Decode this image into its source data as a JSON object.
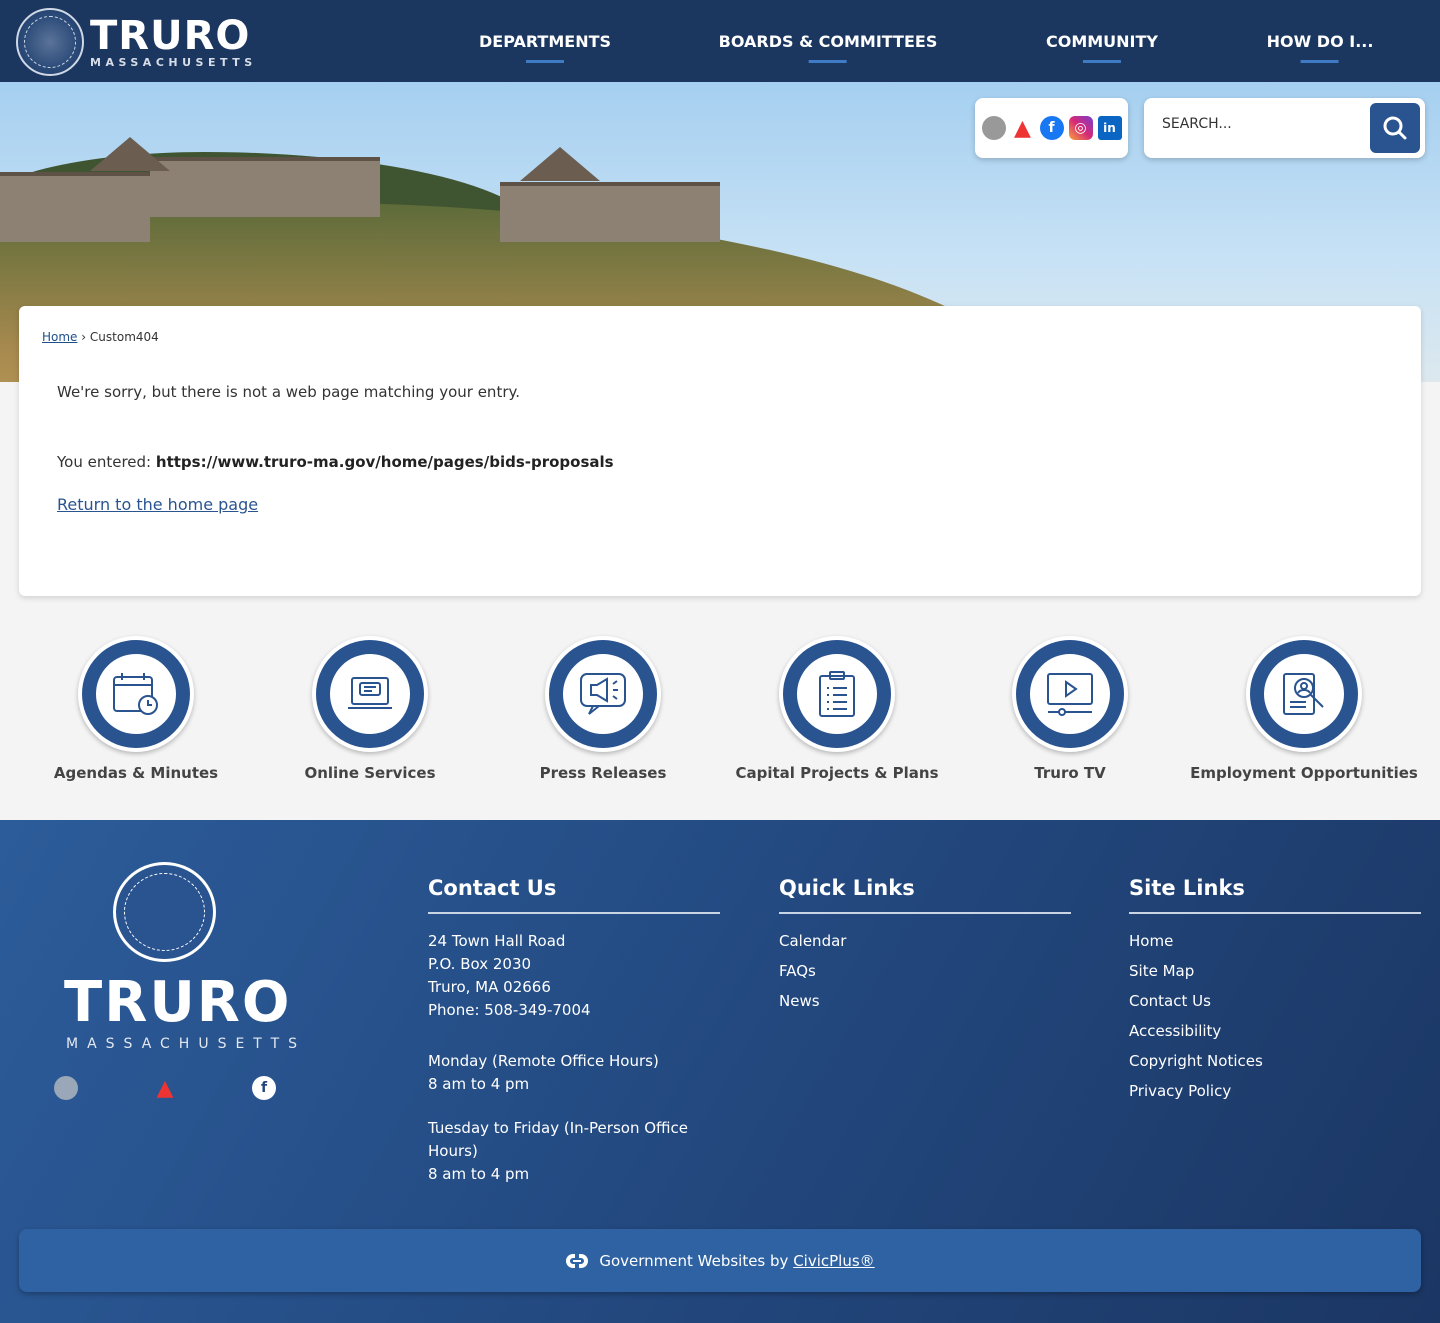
{
  "header": {
    "logo_title": "TRURO",
    "logo_subtitle": "MASSACHUSETTS",
    "nav": [
      "DEPARTMENTS",
      "BOARDS & COMMITTEES",
      "COMMUNITY",
      "HOW DO I..."
    ]
  },
  "search": {
    "placeholder": "SEARCH..."
  },
  "breadcrumb": {
    "home": "Home",
    "sep": "›",
    "current": "Custom404"
  },
  "content": {
    "message": "We're sorry, but there is not a web page matching your entry.",
    "entered_label": "You entered:",
    "entered_url": "https://www.truro-ma.gov/home/pages/bids-proposals",
    "return_link": "Return to the home page"
  },
  "tiles": [
    "Agendas & Minutes",
    "Online Services",
    "Press Releases",
    "Capital Projects & Plans",
    "Truro TV",
    "Employment Opportunities"
  ],
  "footer": {
    "logo_title": "TRURO",
    "logo_subtitle": "MASSACHUSETTS",
    "contact": {
      "heading": "Contact Us",
      "lines": [
        "24 Town Hall Road",
        "P.O. Box 2030",
        "Truro, MA 02666",
        "Phone: 508-349-7004"
      ],
      "hours1": [
        "Monday (Remote Office Hours)",
        "8 am to 4 pm"
      ],
      "hours2": [
        "Tuesday to Friday (In-Person Office Hours)",
        "8 am to 4 pm"
      ]
    },
    "quick": {
      "heading": "Quick Links",
      "links": [
        "Calendar",
        "FAQs",
        "News"
      ]
    },
    "site": {
      "heading": "Site Links",
      "links": [
        "Home",
        "Site Map",
        "Contact Us",
        "Accessibility",
        "Copyright Notices",
        "Privacy Policy"
      ]
    },
    "credit": "Government Websites by",
    "credit_link": "CivicPlus®"
  },
  "colors": {
    "navy": "#1b365f",
    "accent": "#2a5490"
  }
}
